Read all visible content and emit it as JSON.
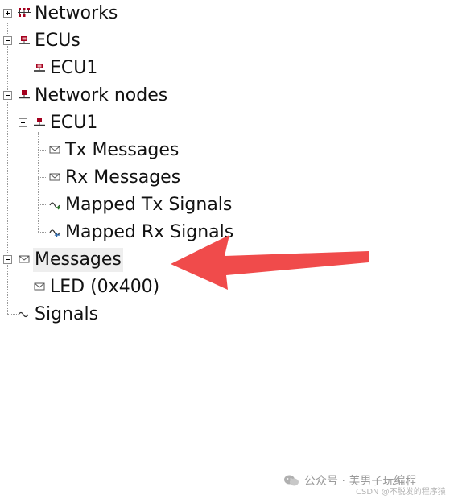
{
  "tree": {
    "items": [
      {
        "label": "Networks",
        "icon": "network-icon",
        "expander": "plus"
      },
      {
        "label": "ECUs",
        "icon": "ecu-icon",
        "expander": "minus"
      },
      {
        "label": "ECU1",
        "icon": "ecu-icon",
        "expander": "plus"
      },
      {
        "label": "Network nodes",
        "icon": "network-node-icon",
        "expander": "minus"
      },
      {
        "label": "ECU1",
        "icon": "network-node-icon",
        "expander": "minus"
      },
      {
        "label": "Tx Messages",
        "icon": "envelope-icon"
      },
      {
        "label": "Rx Messages",
        "icon": "envelope-icon"
      },
      {
        "label": "Mapped Tx Signals",
        "icon": "mapped-tx-signal-icon"
      },
      {
        "label": "Mapped Rx Signals",
        "icon": "mapped-rx-signal-icon"
      },
      {
        "label": "Messages",
        "icon": "envelope-icon",
        "expander": "minus",
        "selected": true
      },
      {
        "label": "LED (0x400)",
        "icon": "envelope-icon"
      },
      {
        "label": "Signals",
        "icon": "signal-wave-icon"
      }
    ]
  },
  "annotation": {
    "arrow_color": "#f04b4b"
  },
  "watermark": {
    "text": "公众号 · 美男子玩编程",
    "csdn": "CSDN @不脱发的程序猿"
  }
}
